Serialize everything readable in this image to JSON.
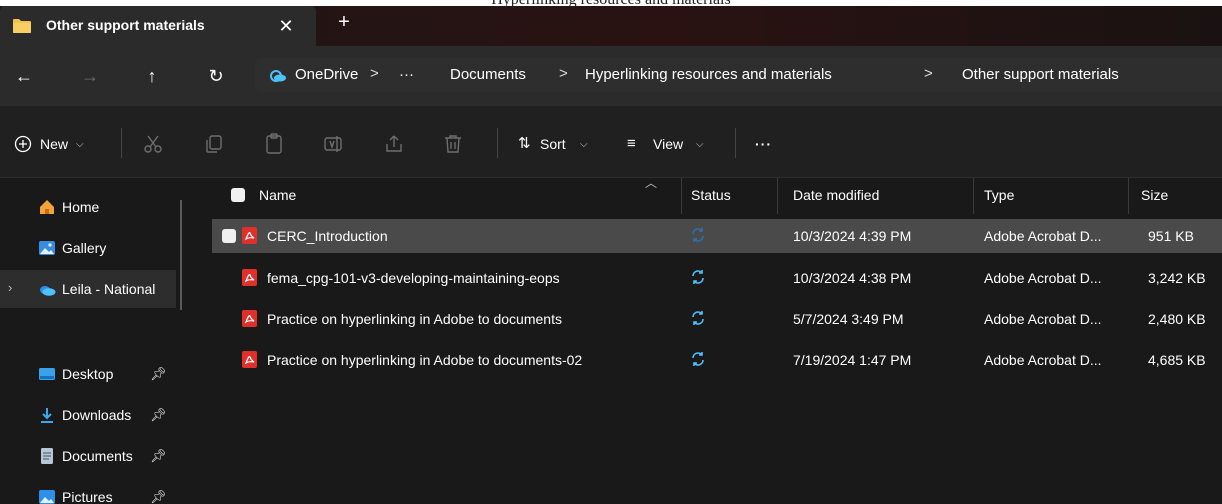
{
  "background_title_fragment": "Hyperlinking resources and materials",
  "tab": {
    "title": "Other support materials",
    "close_symbol": "✕",
    "new_tab_symbol": "+"
  },
  "nav": {
    "back": "←",
    "forward": "→",
    "up": "↑",
    "refresh": "↻"
  },
  "breadcrumb": [
    "OneDrive",
    "···",
    "Documents",
    "Hyperlinking resources and materials",
    "Other support materials"
  ],
  "breadcrumb_separator": ">",
  "commands": {
    "new": "New",
    "sort": "Sort",
    "view": "View",
    "more": "···"
  },
  "sidebar": {
    "top": [
      {
        "label": "Home",
        "icon": "home-icon"
      },
      {
        "label": "Gallery",
        "icon": "gallery-icon"
      },
      {
        "label": "Leila - National",
        "icon": "onedrive-icon"
      }
    ],
    "pinned": [
      {
        "label": "Desktop",
        "icon": "desktop-icon"
      },
      {
        "label": "Downloads",
        "icon": "download-icon"
      },
      {
        "label": "Documents",
        "icon": "documents-icon"
      },
      {
        "label": "Pictures",
        "icon": "pictures-icon"
      }
    ]
  },
  "columns": {
    "name": "Name",
    "status": "Status",
    "date": "Date modified",
    "type": "Type",
    "size": "Size"
  },
  "files": [
    {
      "name": "CERC_Introduction",
      "date": "10/3/2024 4:39 PM",
      "type": "Adobe Acrobat D...",
      "size": "951 KB",
      "selected": true
    },
    {
      "name": "fema_cpg-101-v3-developing-maintaining-eops",
      "date": "10/3/2024 4:38 PM",
      "type": "Adobe Acrobat D...",
      "size": "3,242 KB",
      "selected": false
    },
    {
      "name": "Practice on hyperlinking in Adobe to documents",
      "date": "5/7/2024 3:49 PM",
      "type": "Adobe Acrobat D...",
      "size": "2,480 KB",
      "selected": false
    },
    {
      "name": "Practice on hyperlinking in Adobe to documents-02",
      "date": "7/19/2024 1:47 PM",
      "type": "Adobe Acrobat D...",
      "size": "4,685 KB",
      "selected": false
    }
  ],
  "colors": {
    "accent_blue": "#4cc2ff",
    "pdf_red": "#e0302b",
    "folder_yellow": "#f2c14e",
    "selected_row": "#4a4a4a"
  }
}
